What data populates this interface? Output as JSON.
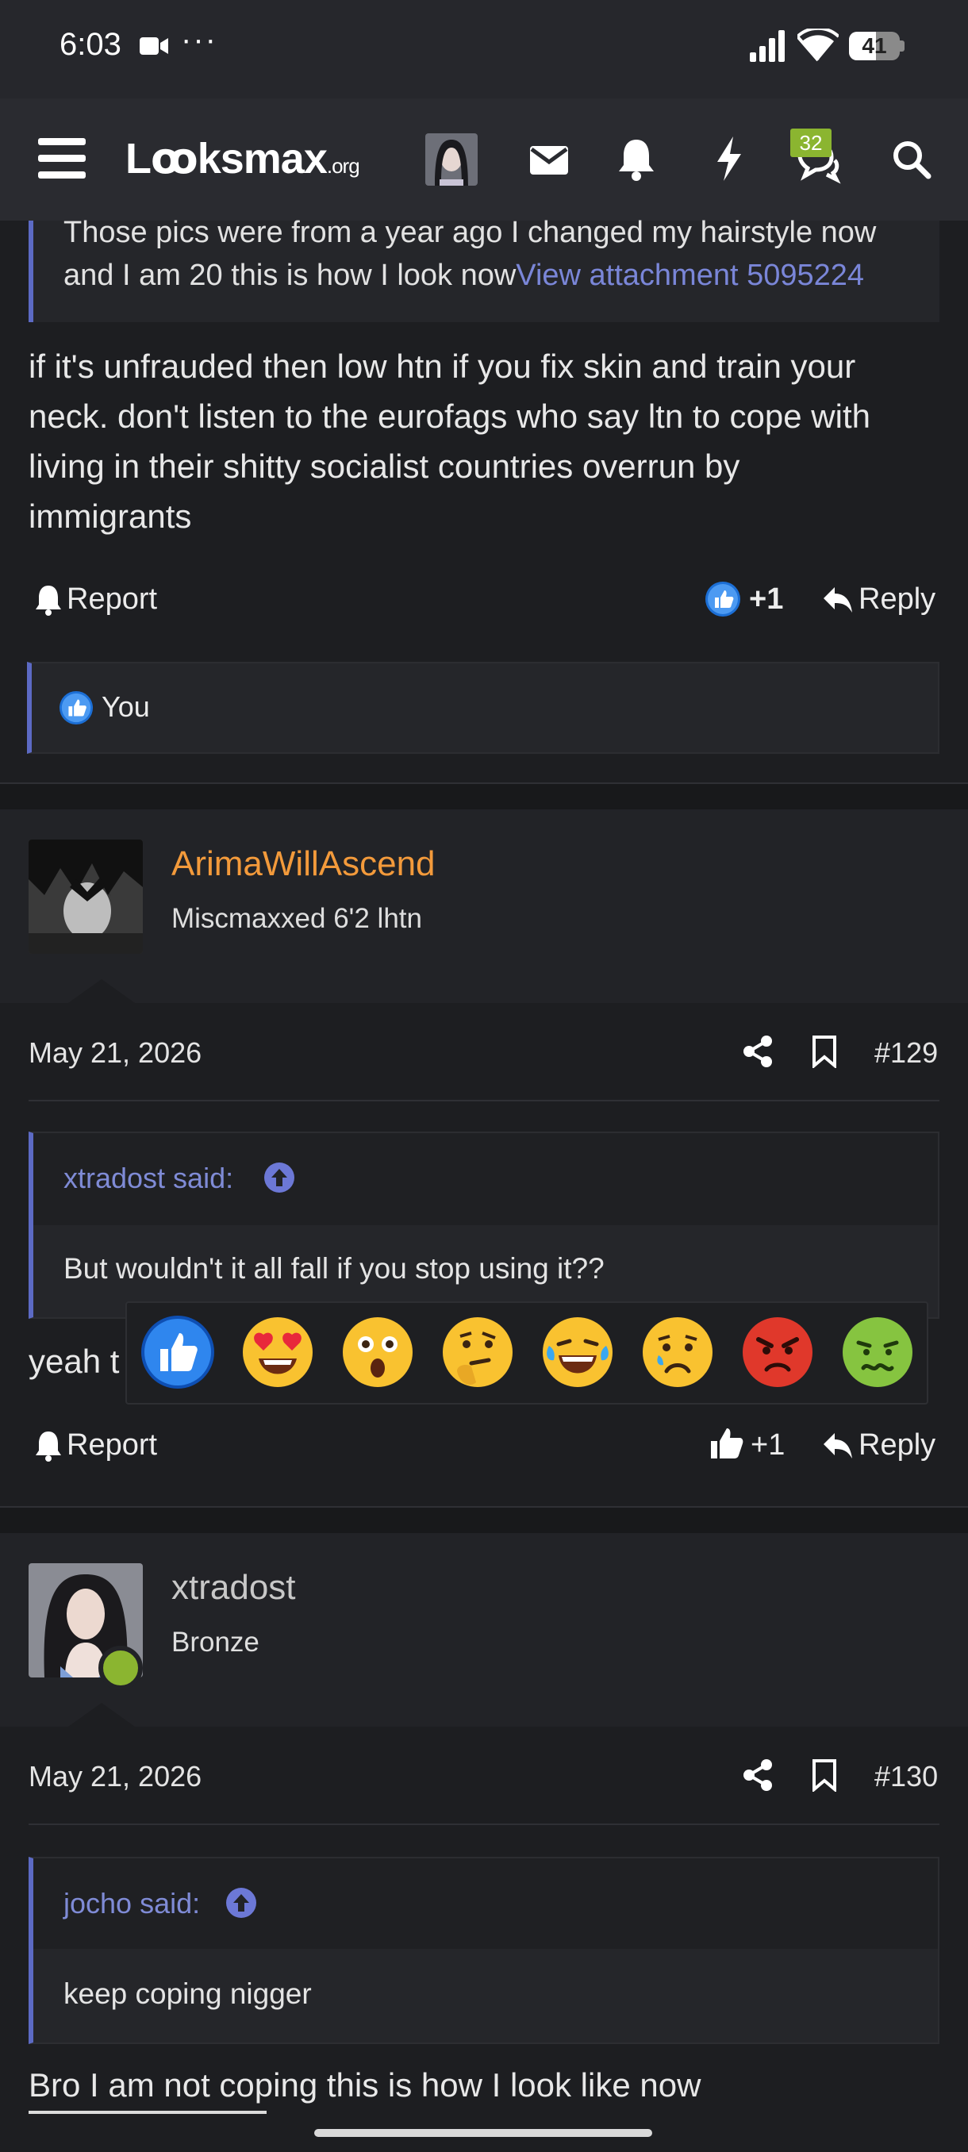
{
  "status_bar": {
    "time": "6:03",
    "dots": "···",
    "battery": "41",
    "camera_icon": "video-camera-icon",
    "signal_icon": "signal-bars-icon",
    "wifi_icon": "wifi-icon"
  },
  "navbar": {
    "logo_main": "Lꝏksmax",
    "logo_suffix": ".org",
    "chat_badge": "32",
    "icons": [
      "menu-icon",
      "avatar",
      "envelope-icon",
      "bell-icon",
      "bolt-icon",
      "chat-icon",
      "search-icon"
    ]
  },
  "post128": {
    "quote_line1": "Those pics were from a year ago I changed my hairstyle now",
    "quote_line2": "and I am 20 this is how I look now",
    "quote_link": "View attachment 5095224",
    "body_lines": [
      "if it's unfrauded then low htn if you fix skin and train your",
      "neck. don't listen to the eurofags who say ltn to cope with",
      "living in their shitty socialist countries overrun by",
      "immigrants"
    ],
    "report": "Report",
    "reaction_count": "+1",
    "reply": "Reply",
    "reactions_by": "You"
  },
  "post129": {
    "username": "ArimaWillAscend",
    "user_title": "Miscmaxxed 6'2 lhtn",
    "date": "May 21, 2026",
    "number": "#129",
    "quote_attribution": "xtradost said:",
    "quote_text": "But wouldn't it all fall if you stop using it??",
    "body_partial": "yeah t",
    "report": "Report",
    "reaction_count": "+1",
    "reply": "Reply"
  },
  "reaction_picker": {
    "emojis": [
      "like",
      "love",
      "wow",
      "thinking",
      "haha",
      "sad",
      "angry",
      "sick"
    ]
  },
  "post130": {
    "username": "xtradost",
    "user_title": "Bronze",
    "date": "May 21, 2026",
    "number": "#130",
    "quote_attribution": "jocho said:",
    "quote_text": "keep coping nigger",
    "body_line": "Bro I am not coping this is how I look like now"
  },
  "colors": {
    "accent": "#5c6ac4",
    "link": "#7a86d8",
    "username_orange": "#f39a3b",
    "online": "#8bb530"
  }
}
